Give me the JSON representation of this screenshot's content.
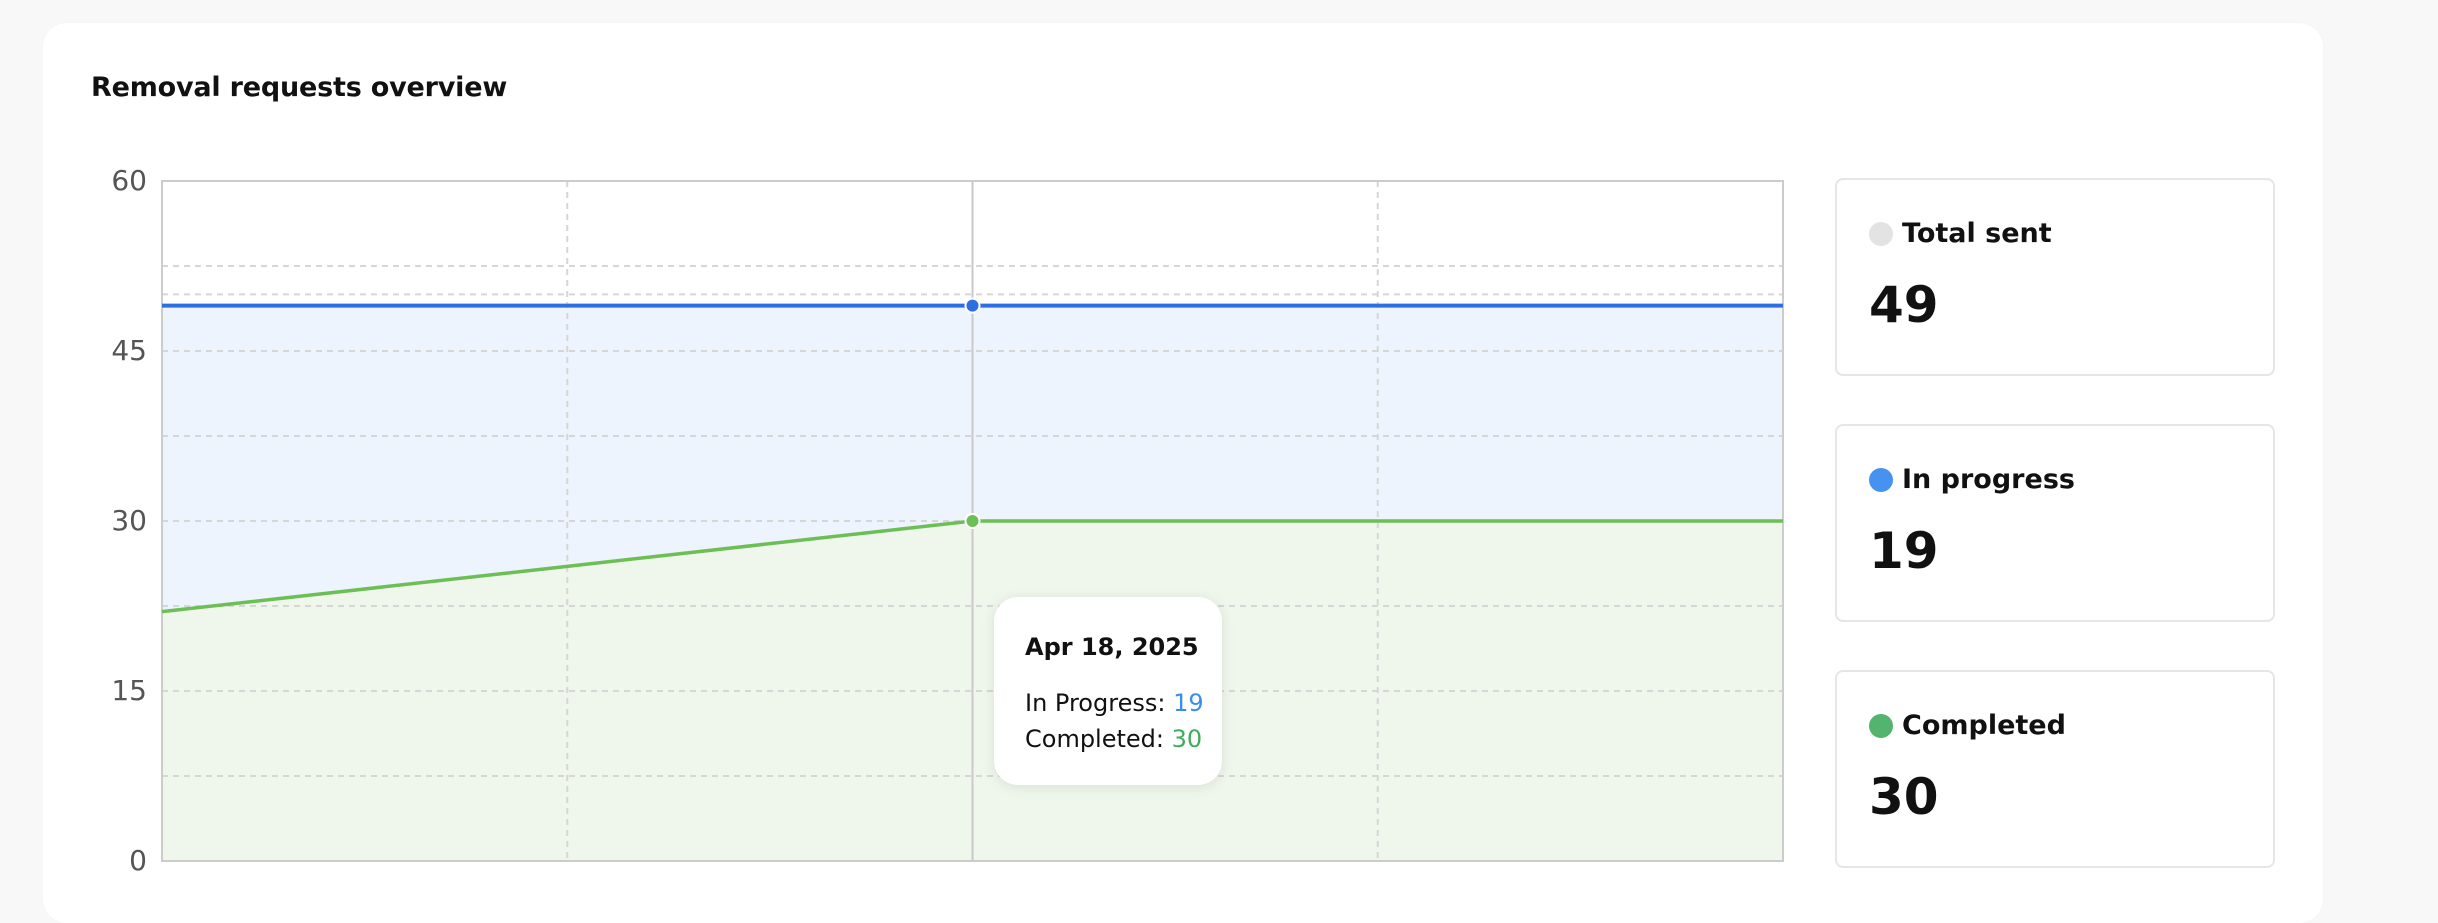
{
  "card": {
    "title": "Removal requests overview"
  },
  "tooltip": {
    "date": "Apr 18, 2025",
    "in_progress_label": "In Progress:",
    "in_progress_value": "19",
    "completed_label": "Completed:",
    "completed_value": "30"
  },
  "stats": [
    {
      "label": "Total sent",
      "value": "49",
      "color": "#e3e3e3"
    },
    {
      "label": "In progress",
      "value": "19",
      "color": "#4593ef"
    },
    {
      "label": "Completed",
      "value": "30",
      "color": "#52b46e"
    }
  ],
  "chart_data": {
    "type": "area",
    "title": "Removal requests overview",
    "xlabel": "",
    "ylabel": "",
    "ylim": [
      0,
      60
    ],
    "yticks": [
      0,
      15,
      30,
      45,
      60
    ],
    "grid": true,
    "stacked": true,
    "x": [
      0,
      1,
      2,
      3,
      4
    ],
    "series": [
      {
        "name": "Completed",
        "color": "#6cbf55",
        "fill": "#eff7ed",
        "values": [
          22,
          26,
          30,
          30,
          30
        ]
      },
      {
        "name": "In Progress",
        "color": "#2f6ee0",
        "fill": "#edf4fd",
        "values": [
          27,
          23,
          19,
          19,
          19
        ]
      }
    ],
    "highlight_index": 2
  },
  "colors": {
    "in_progress_line": "#2f6ee0",
    "completed_line": "#6cbf55",
    "in_progress_fill": "#edf4fd",
    "completed_fill": "#eff7ed",
    "grid": "#d6d6d6",
    "axis": "#cccccc"
  }
}
